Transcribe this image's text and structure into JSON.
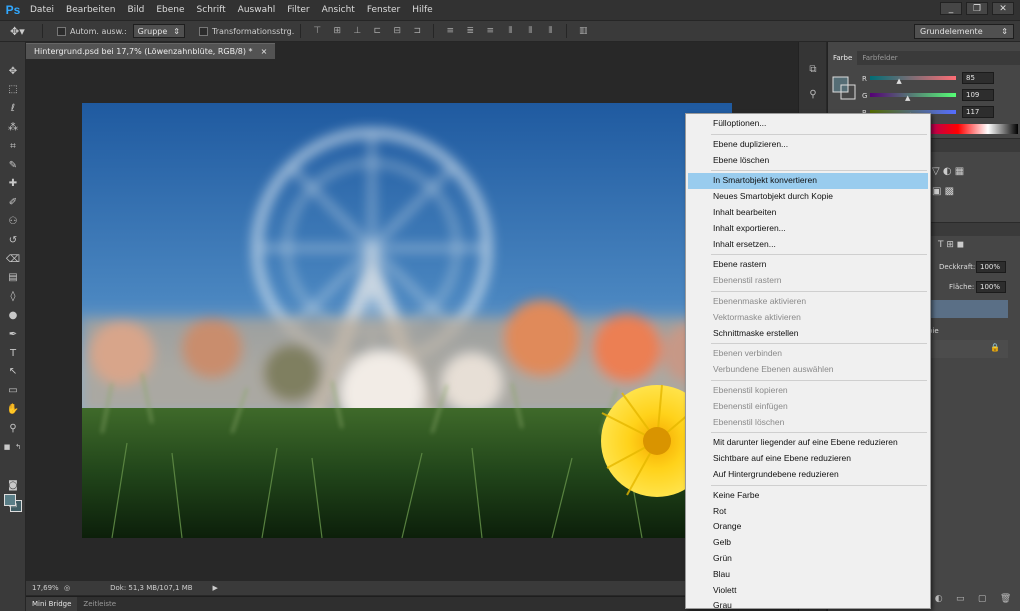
{
  "app": {
    "logo": "Ps"
  },
  "menubar": {
    "items": [
      "Datei",
      "Bearbeiten",
      "Bild",
      "Ebene",
      "Schrift",
      "Auswahl",
      "Filter",
      "Ansicht",
      "Fenster",
      "Hilfe"
    ]
  },
  "window_controls": {
    "minimize": "_",
    "restore": "❐",
    "close": "✕"
  },
  "options_bar": {
    "auto_select_label": "Autom. ausw.:",
    "group_select": "Gruppe",
    "transform_label": "Transformationsstrg.",
    "workspace": "Grundelemente"
  },
  "document": {
    "tab_title": "Hintergrund.psd bei 17,7% (Löwenzahnblüte, RGB/8) *",
    "close": "×"
  },
  "status": {
    "zoom": "17,69%",
    "doc_info": "Dok: 51,3 MB/107,1 MB",
    "arrow": "▶"
  },
  "bottom_tabs": [
    "Mini Bridge",
    "Zeitleiste"
  ],
  "color_panel": {
    "tabs": [
      "Farbe",
      "Farbfelder"
    ],
    "channels": [
      {
        "label": "R",
        "value": "85",
        "gradient": "linear-gradient(to right,#006d75,#ff6d75)",
        "level": 0.33
      },
      {
        "label": "G",
        "value": "109",
        "gradient": "linear-gradient(to right,#550075,#55ff75)",
        "level": 0.43
      },
      {
        "label": "B",
        "value": "117",
        "gradient": "linear-gradient(to right,#556d00,#556dff)",
        "level": 0.46
      }
    ],
    "fg_color": "#556d75"
  },
  "layers_panel": {
    "opacity_label": "Deckkraft:",
    "opacity_value": "100%",
    "fill_label": "Fläche:",
    "fill_value": "100%",
    "partial_row_text": "pie"
  },
  "context_menu": {
    "groups": [
      [
        {
          "label": "Fülloptionen...",
          "enabled": true
        }
      ],
      [
        {
          "label": "Ebene duplizieren...",
          "enabled": true
        },
        {
          "label": "Ebene löschen",
          "enabled": true
        }
      ],
      [
        {
          "label": "In Smartobjekt konvertieren",
          "enabled": true,
          "highlighted": true
        },
        {
          "label": "Neues Smartobjekt durch Kopie",
          "enabled": true
        },
        {
          "label": "Inhalt bearbeiten",
          "enabled": true
        },
        {
          "label": "Inhalt exportieren...",
          "enabled": true
        },
        {
          "label": "Inhalt ersetzen...",
          "enabled": true
        }
      ],
      [
        {
          "label": "Ebene rastern",
          "enabled": true
        },
        {
          "label": "Ebenenstil rastern",
          "enabled": false
        }
      ],
      [
        {
          "label": "Ebenenmaske aktivieren",
          "enabled": false
        },
        {
          "label": "Vektormaske aktivieren",
          "enabled": false
        },
        {
          "label": "Schnittmaske erstellen",
          "enabled": true
        }
      ],
      [
        {
          "label": "Ebenen verbinden",
          "enabled": false
        },
        {
          "label": "Verbundene Ebenen auswählen",
          "enabled": false
        }
      ],
      [
        {
          "label": "Ebenenstil kopieren",
          "enabled": false
        },
        {
          "label": "Ebenenstil einfügen",
          "enabled": false
        },
        {
          "label": "Ebenenstil löschen",
          "enabled": false
        }
      ],
      [
        {
          "label": "Mit darunter liegender auf eine Ebene reduzieren",
          "enabled": true
        },
        {
          "label": "Sichtbare auf eine Ebene reduzieren",
          "enabled": true
        },
        {
          "label": "Auf Hintergrundebene reduzieren",
          "enabled": true
        }
      ],
      [
        {
          "label": "Keine Farbe",
          "enabled": true
        },
        {
          "label": "Rot",
          "enabled": true
        },
        {
          "label": "Orange",
          "enabled": true
        },
        {
          "label": "Gelb",
          "enabled": true
        },
        {
          "label": "Grün",
          "enabled": true
        },
        {
          "label": "Blau",
          "enabled": true
        },
        {
          "label": "Violett",
          "enabled": true
        },
        {
          "label": "Grau",
          "enabled": true
        }
      ]
    ]
  },
  "tools": [
    "move-tool-icon",
    "marquee-tool-icon",
    "lasso-tool-icon",
    "quick-select-tool-icon",
    "crop-tool-icon",
    "eyedropper-tool-icon",
    "healing-brush-tool-icon",
    "brush-tool-icon",
    "clone-stamp-tool-icon",
    "history-brush-tool-icon",
    "eraser-tool-icon",
    "gradient-tool-icon",
    "blur-tool-icon",
    "dodge-tool-icon",
    "pen-tool-icon",
    "type-tool-icon",
    "path-select-tool-icon",
    "rectangle-tool-icon",
    "hand-tool-icon",
    "zoom-tool-icon"
  ]
}
